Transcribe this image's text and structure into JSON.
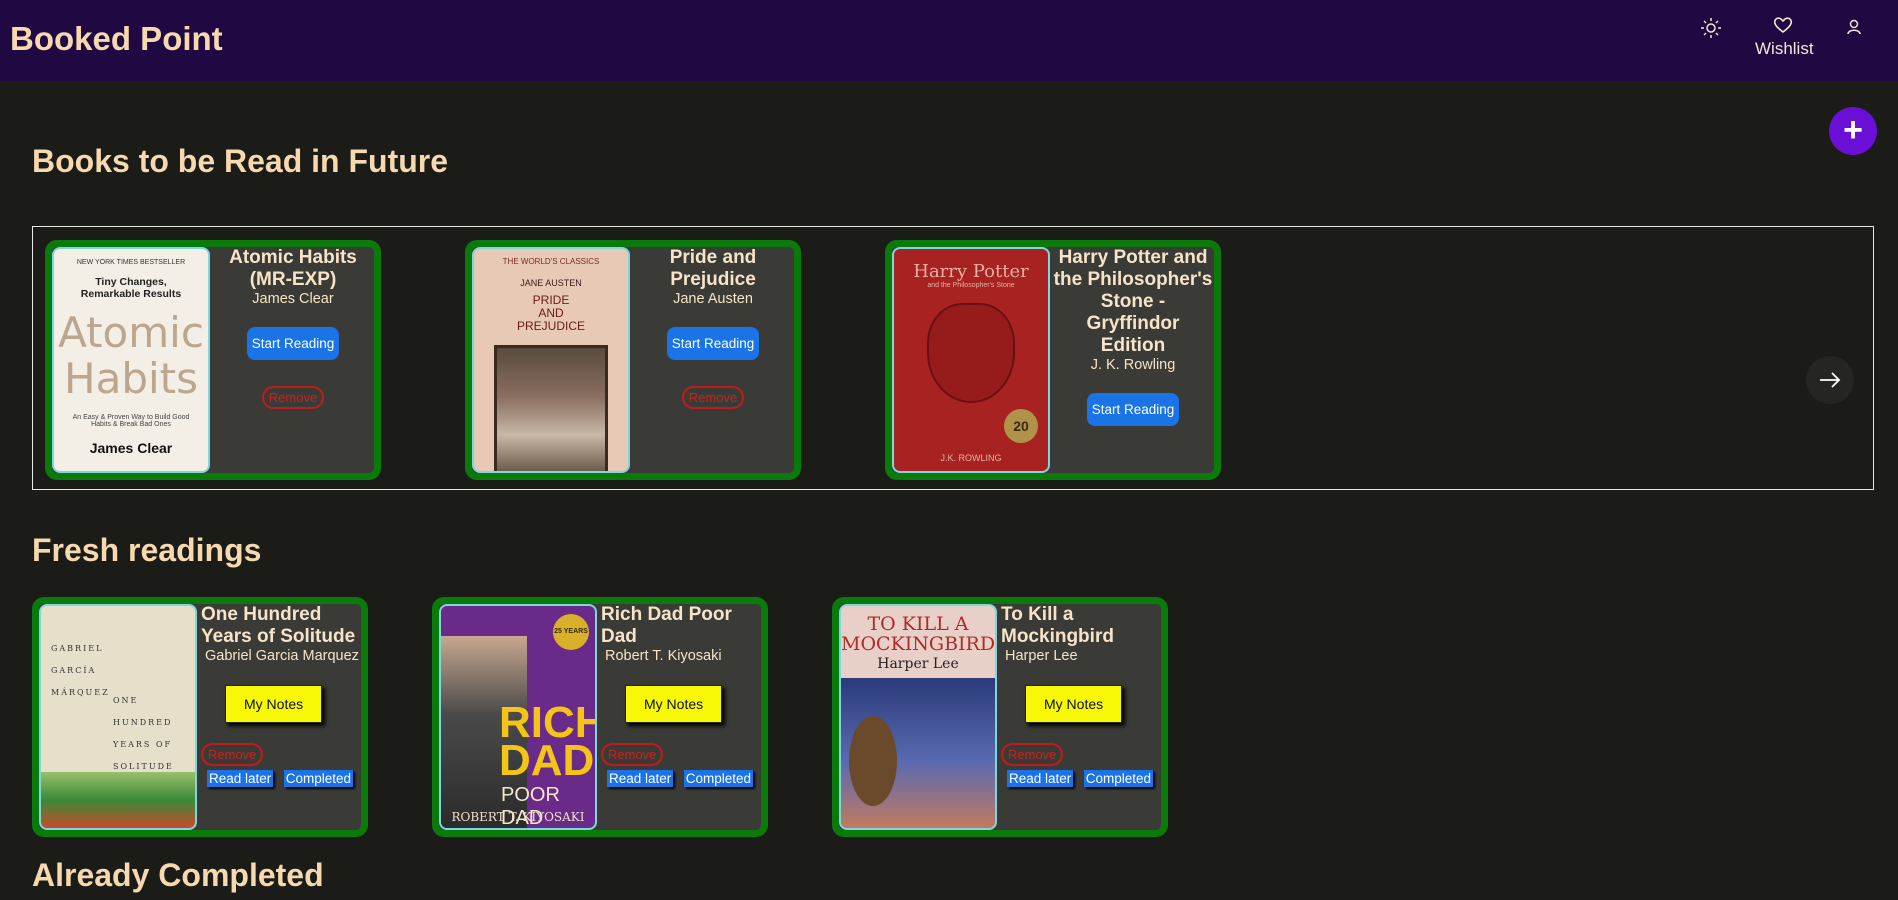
{
  "header": {
    "brand": "Booked Point",
    "wishlist_label": "Wishlist"
  },
  "icons": {
    "theme": "sun-icon",
    "wishlist": "heart-icon",
    "profile": "user-icon",
    "add": "plus-icon",
    "next": "arrow-right-icon"
  },
  "fab": {
    "label": "+"
  },
  "future": {
    "title": "Books to be Read in Future",
    "books": [
      {
        "title": "Atomic Habits (MR-EXP)",
        "author": "James Clear",
        "start_label": "Start Reading",
        "remove_label": "Remove",
        "cover": {
          "top": "NEW YORK TIMES BESTSELLER",
          "subtitle": "Tiny Changes, Remarkable Results",
          "title1": "Atomic",
          "title2": "Habits",
          "tag": "An Easy & Proven Way to Build Good Habits & Break Bad Ones",
          "author": "James Clear"
        }
      },
      {
        "title": "Pride and Prejudice",
        "author": "Jane Austen",
        "start_label": "Start Reading",
        "remove_label": "Remove",
        "cover": {
          "top": "THE WORLD'S CLASSICS",
          "author": "JANE AUSTEN",
          "title1": "PRIDE",
          "title2": "AND",
          "title3": "PREJUDICE"
        }
      },
      {
        "title": "Harry Potter and the Philosopher's Stone - Gryffindor Edition",
        "author": "J. K. Rowling",
        "start_label": "Start Reading",
        "cover": {
          "title": "Harry Potter",
          "subtitle": "and the Philosopher's Stone",
          "author": "J.K. ROWLING",
          "badge": "20"
        }
      }
    ]
  },
  "fresh": {
    "title": "Fresh readings",
    "books": [
      {
        "title": "One Hundred Years of Solitude",
        "author": "Gabriel Garcia Marquez",
        "notes_label": "My Notes",
        "remove_label": "Remove",
        "later_label": "Read later",
        "completed_label": "Completed",
        "cover": {
          "a1": "GABRIEL",
          "a2": "GARCÍA",
          "a3": "MÁRQUEZ",
          "t1": "ONE",
          "t2": "HUNDRED",
          "t3": "YEARS OF",
          "t4": "SOLITUDE"
        }
      },
      {
        "title": "Rich Dad Poor Dad",
        "author": "Robert T. Kiyosaki",
        "notes_label": "My Notes",
        "remove_label": "Remove",
        "later_label": "Read later",
        "completed_label": "Completed",
        "cover": {
          "t1": "RICH",
          "t2": "DAD",
          "t3": "POOR DAD",
          "author": "ROBERT T. KIYOSAKI",
          "badge": "25 YEARS"
        }
      },
      {
        "title": "To Kill a Mockingbird",
        "author": "Harper Lee",
        "notes_label": "My Notes",
        "remove_label": "Remove",
        "later_label": "Read later",
        "completed_label": "Completed",
        "cover": {
          "t1": "TO KILL A",
          "t2": "MOCKINGBIRD",
          "author": "Harper Lee"
        }
      }
    ]
  },
  "completed": {
    "title": "Already Completed"
  }
}
